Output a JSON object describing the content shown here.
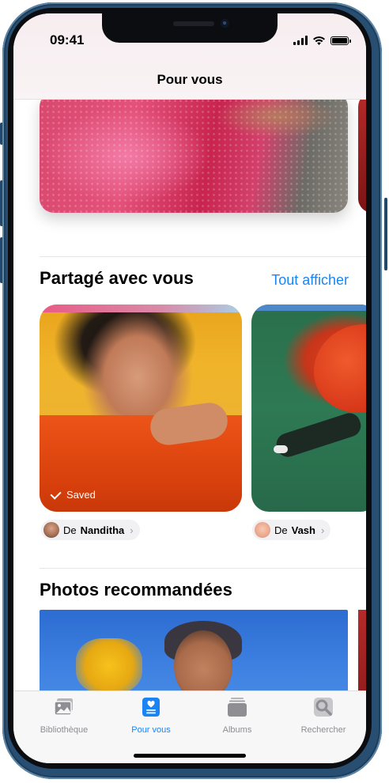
{
  "status_bar": {
    "time": "09:41"
  },
  "header": {
    "title": "Pour vous"
  },
  "shared_section": {
    "title": "Partagé avec vous",
    "see_all": "Tout afficher",
    "cards": [
      {
        "badge": "Saved",
        "from_prefix": "De",
        "from_name": "Nanditha"
      },
      {
        "from_prefix": "De",
        "from_name": "Vash"
      }
    ]
  },
  "recommended_section": {
    "title": "Photos recommandées"
  },
  "tabbar": {
    "tabs": [
      {
        "label": "Bibliothèque",
        "icon": "photos-library-icon",
        "active": false
      },
      {
        "label": "Pour vous",
        "icon": "for-you-icon",
        "active": true
      },
      {
        "label": "Albums",
        "icon": "albums-icon",
        "active": false
      },
      {
        "label": "Rechercher",
        "icon": "search-icon",
        "active": false
      }
    ]
  },
  "colors": {
    "accent": "#1b84f5",
    "inactive": "#8e8e93",
    "frame": "#284f72"
  }
}
